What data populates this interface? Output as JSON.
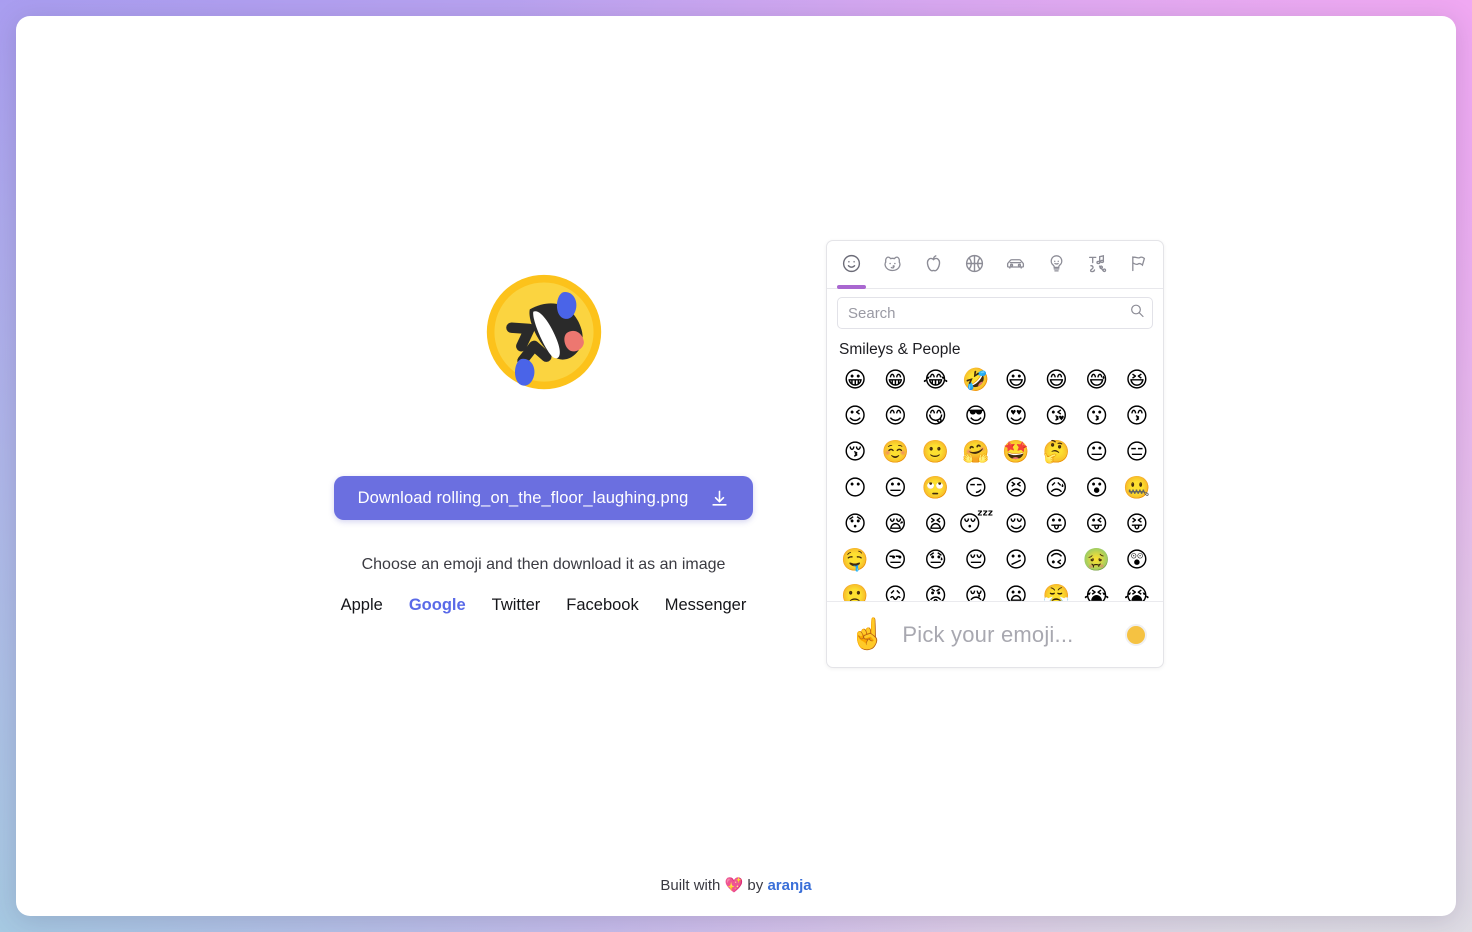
{
  "theme": {
    "accent_button": "#6b6fe0",
    "accent_link": "#5a6ae8",
    "tab_indicator": "#a967d0",
    "footer_link": "#3a6fd8",
    "skin_tone": "#f5c242",
    "bg_top_left": "#a99cf0",
    "bg_top_right": "#f0a8f2",
    "bg_bottom_left": "#a6c9e2",
    "bg_bottom_right": "#dedee4"
  },
  "preview": {
    "emoji_name": "rolling-on-the-floor-laughing",
    "emoji_char": "🤣"
  },
  "download": {
    "label": "Download rolling_on_the_floor_laughing.png",
    "icon": "download-icon"
  },
  "helper_text": "Choose an emoji and then download it as an image",
  "vendors": [
    {
      "label": "Apple",
      "active": false
    },
    {
      "label": "Google",
      "active": true
    },
    {
      "label": "Twitter",
      "active": false
    },
    {
      "label": "Facebook",
      "active": false
    },
    {
      "label": "Messenger",
      "active": false
    }
  ],
  "picker": {
    "tabs": [
      {
        "icon": "smiley-face-icon",
        "name": "smileys-people",
        "active": true
      },
      {
        "icon": "dog-face-icon",
        "name": "animals-nature",
        "active": false
      },
      {
        "icon": "apple-icon",
        "name": "food-drink",
        "active": false
      },
      {
        "icon": "basketball-icon",
        "name": "activity",
        "active": false
      },
      {
        "icon": "car-icon",
        "name": "travel-places",
        "active": false
      },
      {
        "icon": "lightbulb-icon",
        "name": "objects",
        "active": false
      },
      {
        "icon": "symbols-icon",
        "name": "symbols",
        "active": false
      },
      {
        "icon": "flag-icon",
        "name": "flags",
        "active": false
      }
    ],
    "search": {
      "placeholder": "Search",
      "value": "",
      "icon": "search-icon"
    },
    "category_title": "Smileys & People",
    "emojis": [
      "😀",
      "😁",
      "😂",
      "🤣",
      "😃",
      "😄",
      "😅",
      "😆",
      "😉",
      "😊",
      "😋",
      "😎",
      "😍",
      "😘",
      "😗",
      "😙",
      "😚",
      "☺️",
      "🙂",
      "🤗",
      "🤩",
      "🤔",
      "😐",
      "😑",
      "😶",
      "😐",
      "🙄",
      "😏",
      "😣",
      "😥",
      "😮",
      "🤐",
      "😯",
      "😪",
      "😫",
      "😴",
      "😌",
      "😛",
      "😜",
      "😝",
      "🤤",
      "😒",
      "😓",
      "😔",
      "😕",
      "🙃",
      "🤢",
      "😲",
      "🙁",
      "😖",
      "😡",
      "😢",
      "😦",
      "😤",
      "😭",
      "😭"
    ],
    "footer": {
      "pointer_emoji": "☝️",
      "placeholder": "Pick your emoji...",
      "skin_tone_name": "skin-tone-selector"
    }
  },
  "app_footer": {
    "prefix": "Built with ",
    "heart": "💖",
    "middle": " by ",
    "link": "aranja"
  }
}
